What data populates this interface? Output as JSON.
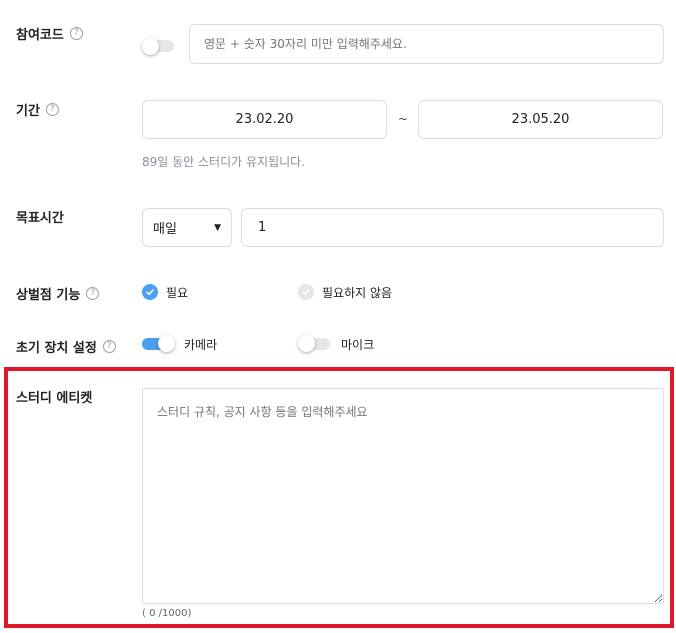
{
  "participation_code": {
    "label": "참여코드",
    "help": "?",
    "placeholder": "영문 + 숫자 30자리 미만 입력해주세요."
  },
  "period": {
    "label": "기간",
    "help": "?",
    "start_date": "23.02.20",
    "separator": "~",
    "end_date": "23.05.20",
    "note": "89일 동안 스터디가 유지됩니다."
  },
  "goal_time": {
    "label": "목표시간",
    "frequency_selected": "매일",
    "value": "1"
  },
  "reward_penalty": {
    "label": "상벌점 기능",
    "help": "?",
    "option_required": "필요",
    "option_not_required": "필요하지 않음",
    "selected": "필요"
  },
  "device_setting": {
    "label": "초기 장치 설정",
    "help": "?",
    "camera_label": "카메라",
    "camera_on": true,
    "mic_label": "마이크",
    "mic_on": false
  },
  "study_etiquette": {
    "label": "스터디 에티켓",
    "placeholder": "스터디 규칙, 공지 사항 등을 입력해주세요",
    "counter": "( 0 /1000)"
  },
  "colors": {
    "accent": "#4b9ef0",
    "highlight_border": "#e0192a",
    "muted_text": "#8a9099",
    "border": "#dadde1"
  }
}
